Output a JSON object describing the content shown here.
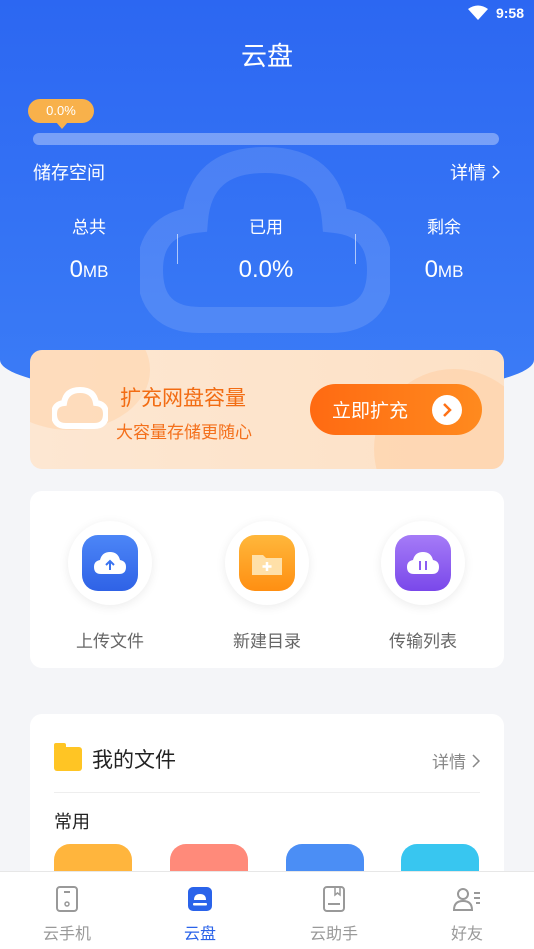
{
  "status": {
    "time": "9:58",
    "wifi_icon": "wifi-icon",
    "battery_icon": "battery-icon"
  },
  "header": {
    "title": "云盘"
  },
  "storage": {
    "usage_badge": "0.0%",
    "usage_fraction": 0.0,
    "label": "储存空间",
    "detail": "详情",
    "stats": {
      "total": {
        "label": "总共",
        "value": "0",
        "unit": "MB"
      },
      "used": {
        "label": "已用",
        "value": "0.0%"
      },
      "remaining": {
        "label": "剩余",
        "value": "0",
        "unit": "MB"
      }
    }
  },
  "promo": {
    "title": "扩充网盘容量",
    "subtitle": "大容量存储更随心",
    "button": "立即扩充"
  },
  "actions": [
    {
      "label": "上传文件",
      "icon": "upload-cloud-icon",
      "color": "#3a73f0"
    },
    {
      "label": "新建目录",
      "icon": "new-folder-icon",
      "color": "#ff9d1c"
    },
    {
      "label": "传输列表",
      "icon": "transfer-cloud-icon",
      "color": "#8c5cf2"
    }
  ],
  "files": {
    "title": "我的文件",
    "detail": "详情",
    "common_label": "常用",
    "tile_colors": [
      "#ffb53d",
      "#ff8a7a",
      "#4b8ef5",
      "#38c6f0"
    ]
  },
  "tabs": [
    {
      "label": "云手机",
      "icon": "phone-icon",
      "active": false
    },
    {
      "label": "云盘",
      "icon": "cloud-disk-icon",
      "active": true
    },
    {
      "label": "云助手",
      "icon": "assistant-icon",
      "active": false
    },
    {
      "label": "好友",
      "icon": "friends-icon",
      "active": false
    }
  ],
  "colors": {
    "primary": "#2c67f2",
    "accent": "#ff6a12"
  }
}
